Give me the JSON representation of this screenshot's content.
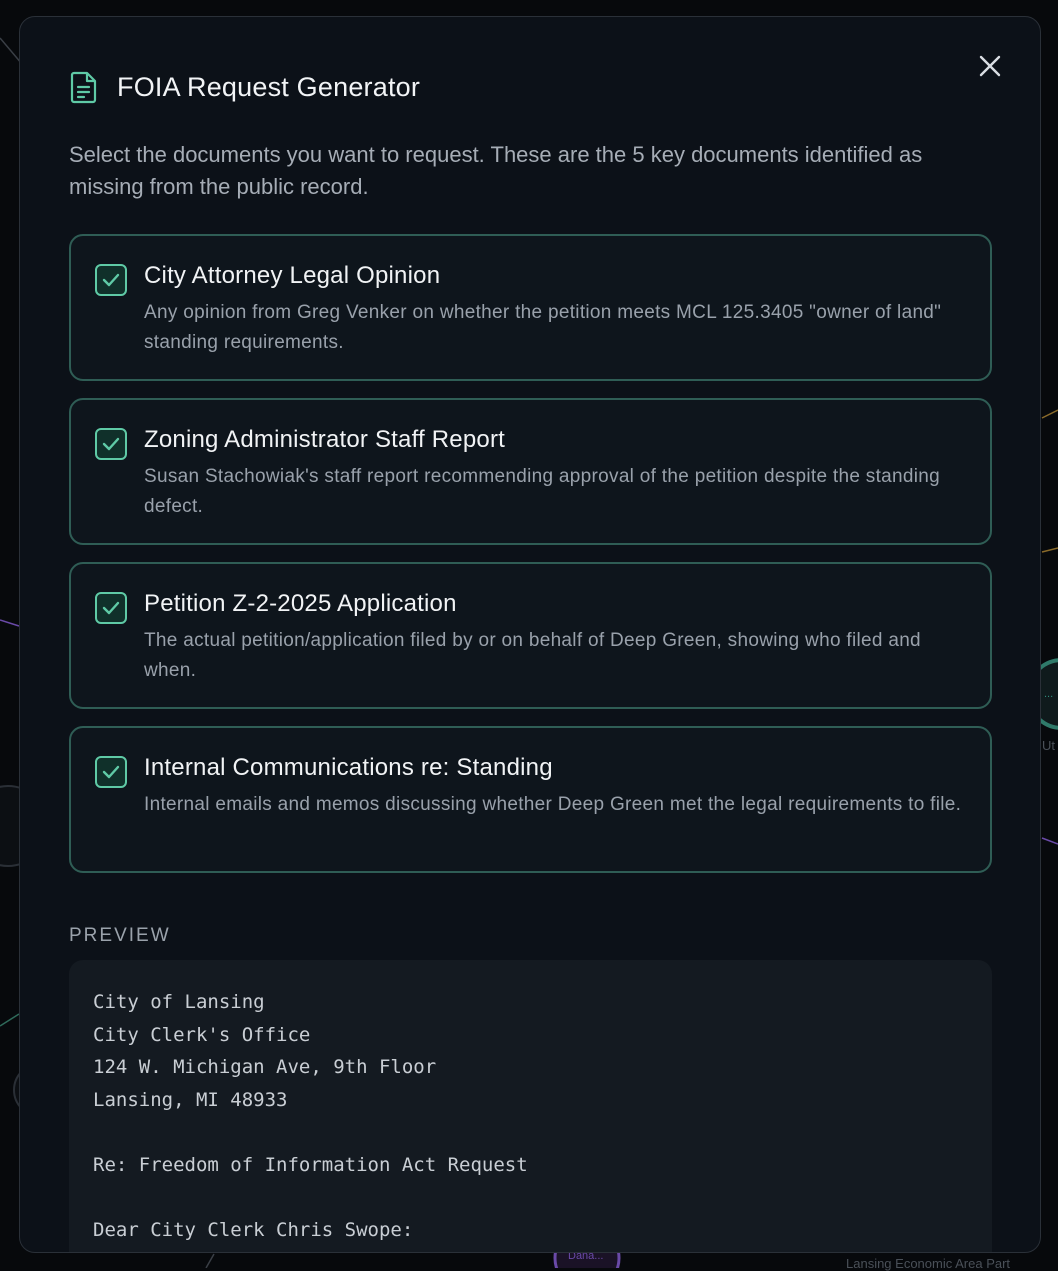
{
  "modal": {
    "title": "FOIA Request Generator",
    "title_icon": "document-icon",
    "close_icon": "close-icon",
    "intro": "Select the documents you want to request. These are the 5 key documents identified as missing from the public record."
  },
  "documents": [
    {
      "title": "City Attorney Legal Opinion",
      "description": "Any opinion from Greg Venker on whether the petition meets MCL 125.3405 \"owner of land\" standing requirements.",
      "checked": true
    },
    {
      "title": "Zoning Administrator Staff Report",
      "description": "Susan Stachowiak's staff report recommending approval of the petition despite the standing defect.",
      "checked": true
    },
    {
      "title": "Petition Z-2-2025 Application",
      "description": "The actual petition/application filed by or on behalf of Deep Green, showing who filed and when.",
      "checked": true
    },
    {
      "title": "Internal Communications re: Standing",
      "description": "Internal emails and memos discussing whether Deep Green met the legal requirements to file.",
      "checked": true
    }
  ],
  "preview": {
    "label": "PREVIEW",
    "lines": [
      "City of Lansing",
      "City Clerk's Office",
      "124 W. Michigan Ave, 9th Floor",
      "Lansing, MI 48933",
      "",
      "Re: Freedom of Information Act Request",
      "",
      "Dear City Clerk Chris Swope:"
    ]
  },
  "background": {
    "node_label_bottom": "Dana...",
    "node_label_right": "Ut",
    "node_label_right_dots": "...",
    "footer_text": "Lansing Economic Area Part"
  },
  "colors": {
    "accent": "#5fcaa6",
    "card_border": "#2f5d55",
    "modal_bg": "#0c1118",
    "page_bg": "#07090c"
  }
}
